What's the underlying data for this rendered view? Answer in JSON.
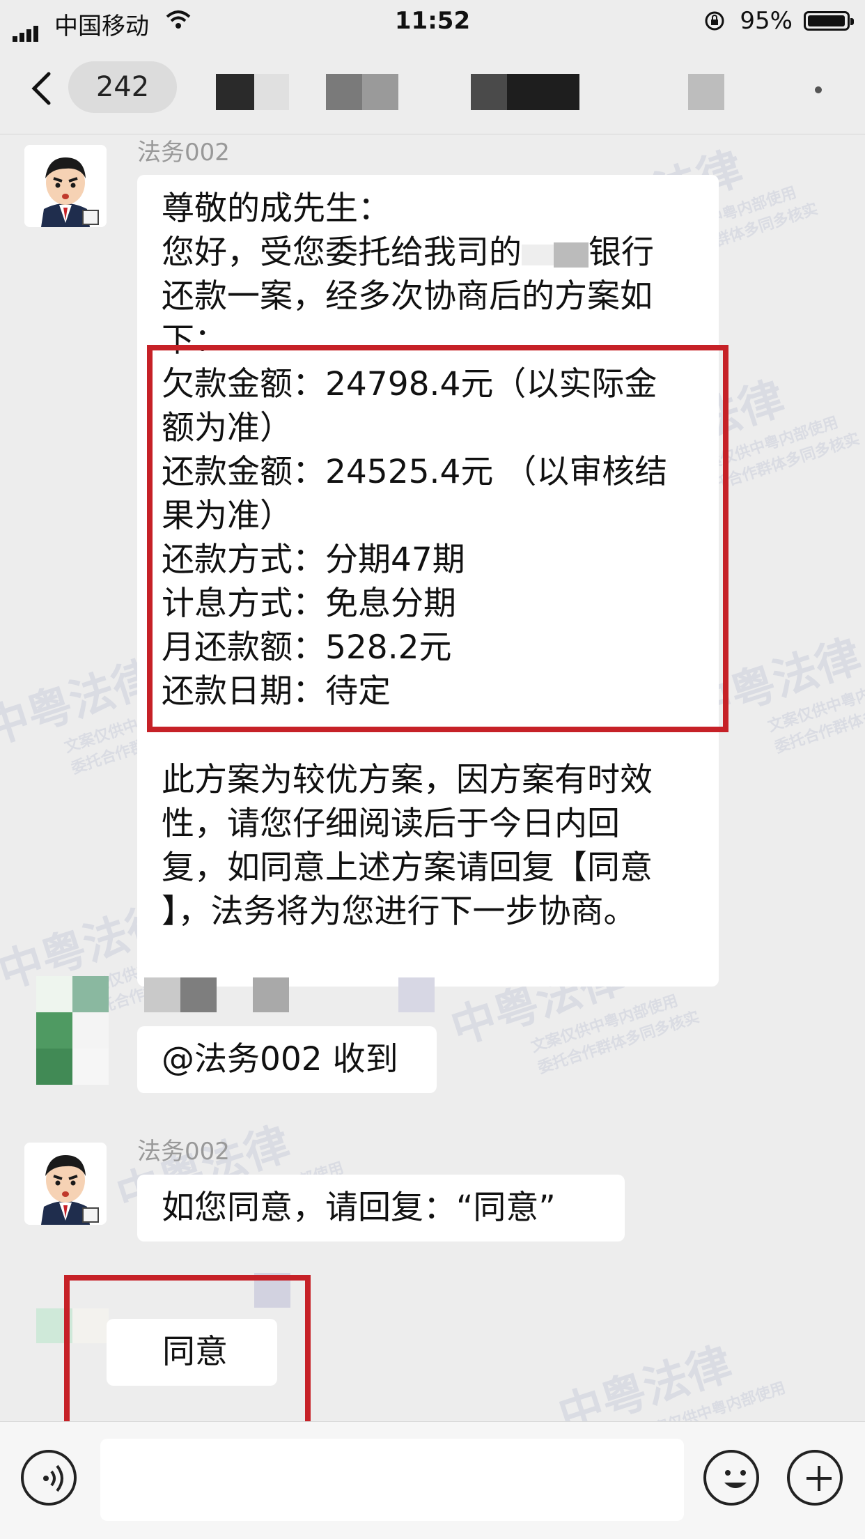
{
  "status_bar": {
    "carrier": "中国移动",
    "time": "11:52",
    "battery": "95%"
  },
  "nav": {
    "unread_count": "242"
  },
  "messages": [
    {
      "sender": "法务002",
      "greeting": "尊敬的成先生：",
      "intro": "您好，受您委托给我司的",
      "intro_tail": "银行",
      "intro2": "还款一案，经多次协商后的方案如",
      "intro3": "下：",
      "plan_lines": [
        "欠款金额：24798.4元（以实际金",
        "额为准）",
        "还款金额：24525.4元 （以审核结",
        "果为准）",
        "还款方式：分期47期",
        "计息方式：免息分期",
        "月还款额：528.2元",
        "还款日期：待定"
      ],
      "closing_lines": [
        "此方案为较优方案，因方案有时效",
        "性，请您仔细阅读后于今日内回",
        "复，如同意上述方案请回复【同意",
        "】，法务将为您进行下一步协商。"
      ]
    },
    {
      "text": "@法务002 收到"
    },
    {
      "sender": "法务002",
      "text": "如您同意，请回复：“同意”"
    },
    {
      "text": "同意"
    }
  ],
  "watermark": {
    "title": "中粤法律",
    "line1": "文案仅供中粤内部使用",
    "line2": "委托合作群体多同多核实"
  },
  "colors": {
    "highlight_border": "#c62127",
    "bubble": "#ffffff",
    "background": "#ededed"
  }
}
